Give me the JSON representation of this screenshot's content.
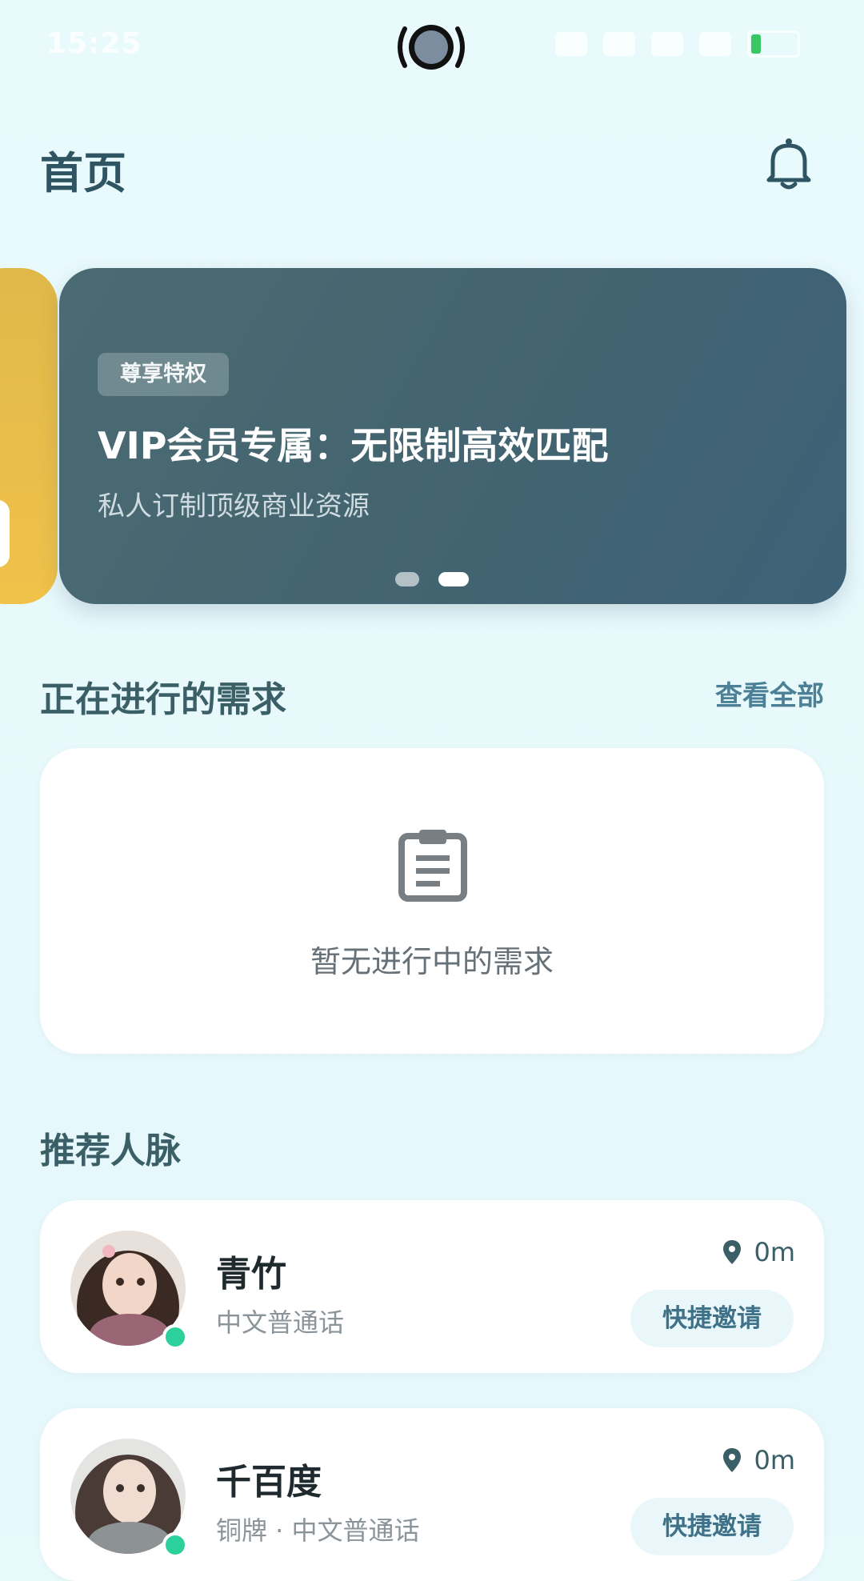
{
  "status_bar": {
    "time": "15:25"
  },
  "header": {
    "title": "首页"
  },
  "banner": {
    "badge": "尊享特权",
    "title": "VIP会员专属：无限制高效匹配",
    "subtitle": "私人订制顶级商业资源",
    "active_index": 1,
    "slide_count": 2
  },
  "ongoing": {
    "title": "正在进行的需求",
    "view_all": "查看全部",
    "empty_text": "暂无进行中的需求"
  },
  "recommend": {
    "title": "推荐人脉",
    "people": [
      {
        "name": "青竹",
        "desc": "中文普通话",
        "distance": "0m",
        "invite": "快捷邀请"
      },
      {
        "name": "千百度",
        "desc": "铜牌 · 中文普通话",
        "distance": "0m",
        "invite": "快捷邀请"
      }
    ]
  },
  "colors": {
    "accent": "#4b8096",
    "online": "#2bd09a",
    "banner_bg": "#44656f"
  }
}
